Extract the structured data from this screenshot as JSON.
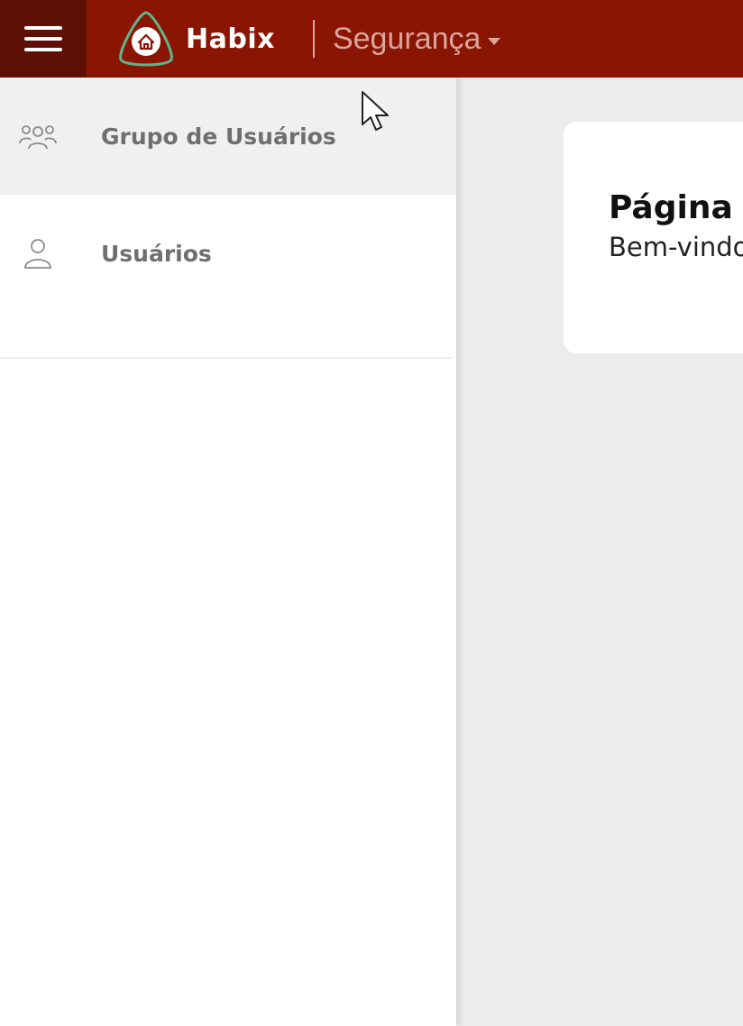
{
  "header": {
    "brand_name": "Habix",
    "module_label": "Segurança",
    "colors": {
      "bar": "#8a1502",
      "menu_bg": "#5e1004",
      "logo_ring": "#5fb48c"
    }
  },
  "sidebar": {
    "items": [
      {
        "label": "Grupo de Usuários",
        "icon": "users-group-icon",
        "active": true
      },
      {
        "label": "Usuários",
        "icon": "user-icon",
        "active": false
      }
    ]
  },
  "main": {
    "card": {
      "title": "Página i",
      "subtitle": "Bem-vindo"
    }
  }
}
